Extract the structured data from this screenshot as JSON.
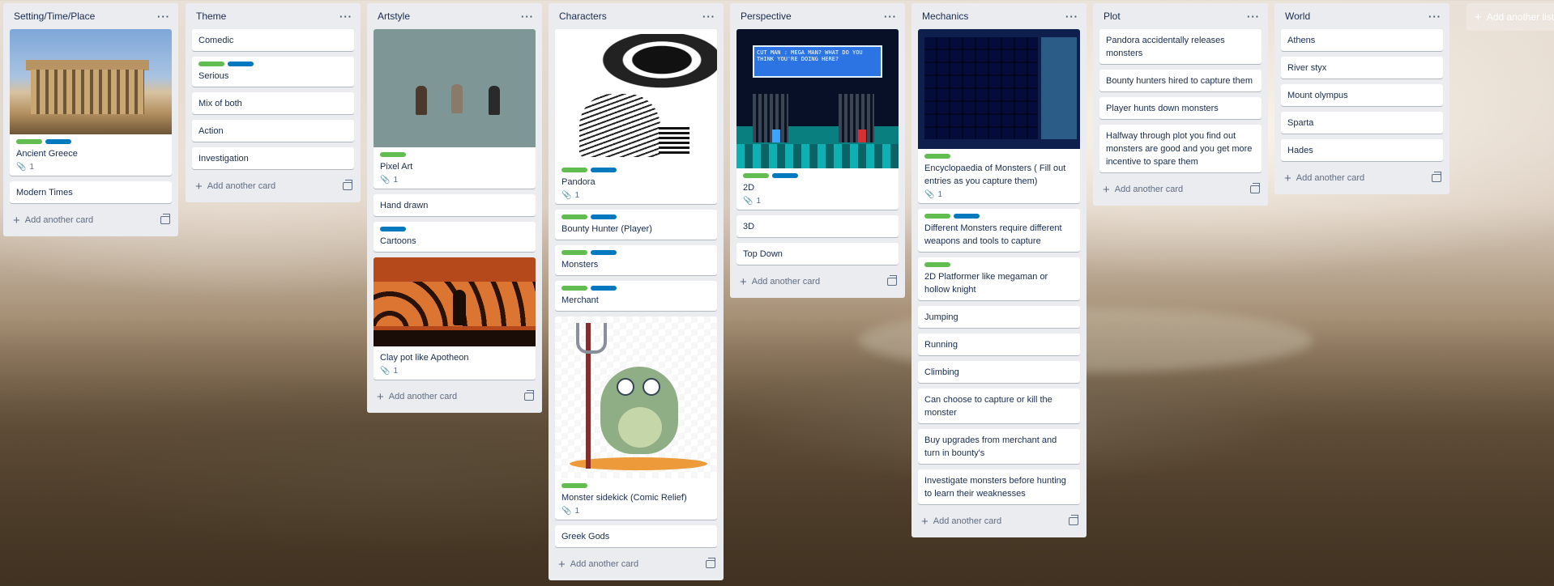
{
  "add_list_label": "Add another list",
  "add_card_label": "Add another card",
  "menu_glyph": "···",
  "lists": [
    {
      "title": "Setting/Time/Place",
      "cards": [
        {
          "text": "Ancient Greece",
          "labels": [
            "green",
            "blue"
          ],
          "attachments": "1",
          "cover": "parthenon-photo"
        },
        {
          "text": "Modern Times"
        }
      ]
    },
    {
      "title": "Theme",
      "cards": [
        {
          "text": "Comedic"
        },
        {
          "text": "Serious",
          "labels": [
            "green",
            "blue"
          ]
        },
        {
          "text": "Mix of both"
        },
        {
          "text": "Action"
        },
        {
          "text": "Investigation"
        }
      ]
    },
    {
      "title": "Artstyle",
      "cards": [
        {
          "text": "Pixel Art",
          "labels": [
            "green"
          ],
          "attachments": "1",
          "cover": "pixel-warriors"
        },
        {
          "text": "Hand drawn"
        },
        {
          "text": "Cartoons",
          "labels": [
            "blue"
          ]
        },
        {
          "text": "Clay pot like Apotheon",
          "attachments": "1",
          "cover": "apotheon-screenshot"
        }
      ]
    },
    {
      "title": "Characters",
      "cards": [
        {
          "text": "Pandora",
          "labels": [
            "green",
            "blue"
          ],
          "attachments": "1",
          "cover": "pandora-drawing"
        },
        {
          "text": "Bounty Hunter (Player)",
          "labels": [
            "green",
            "blue"
          ]
        },
        {
          "text": "Monsters",
          "labels": [
            "green",
            "blue"
          ]
        },
        {
          "text": "Merchant",
          "labels": [
            "green",
            "blue"
          ]
        },
        {
          "text": "Monster sidekick (Comic Relief)",
          "labels": [
            "green"
          ],
          "attachments": "1",
          "cover": "monster-cartoon"
        },
        {
          "text": "Greek Gods"
        }
      ]
    },
    {
      "title": "Perspective",
      "cards": [
        {
          "text": "2D",
          "labels": [
            "green",
            "blue"
          ],
          "attachments": "1",
          "cover": "megaman-screenshot",
          "cover_caption": "CUT MAN : MEGA MAN? WHAT DO YOU THINK YOU'RE DOING HERE?"
        },
        {
          "text": "3D"
        },
        {
          "text": "Top Down"
        }
      ]
    },
    {
      "title": "Mechanics",
      "cards": [
        {
          "text": "Encyclopaedia of Monsters ( Fill out entries as you capture them)",
          "labels": [
            "green"
          ],
          "attachments": "1",
          "cover": "inventory-screenshot"
        },
        {
          "text": "Different Monsters require different weapons and tools to capture",
          "labels": [
            "green",
            "blue"
          ]
        },
        {
          "text": "2D Platformer like megaman or hollow knight",
          "labels": [
            "green"
          ]
        },
        {
          "text": "Jumping"
        },
        {
          "text": "Running"
        },
        {
          "text": "Climbing"
        },
        {
          "text": "Can choose to capture or kill the monster"
        },
        {
          "text": "Buy upgrades from merchant and turn in bounty's"
        },
        {
          "text": "Investigate monsters before hunting to learn their weaknesses"
        }
      ]
    },
    {
      "title": "Plot",
      "cards": [
        {
          "text": "Pandora accidentally releases monsters"
        },
        {
          "text": "Bounty hunters hired to capture them"
        },
        {
          "text": "Player hunts down monsters"
        },
        {
          "text": "Halfway through plot you find out monsters are good and you get more incentive to spare them"
        }
      ]
    },
    {
      "title": "World",
      "cards": [
        {
          "text": "Athens"
        },
        {
          "text": "River styx"
        },
        {
          "text": "Mount olympus"
        },
        {
          "text": "Sparta"
        },
        {
          "text": "Hades"
        }
      ]
    }
  ],
  "colors": {
    "label_green": "#61bd4f",
    "label_blue": "#0079bf",
    "list_bg": "#ebecf0"
  }
}
